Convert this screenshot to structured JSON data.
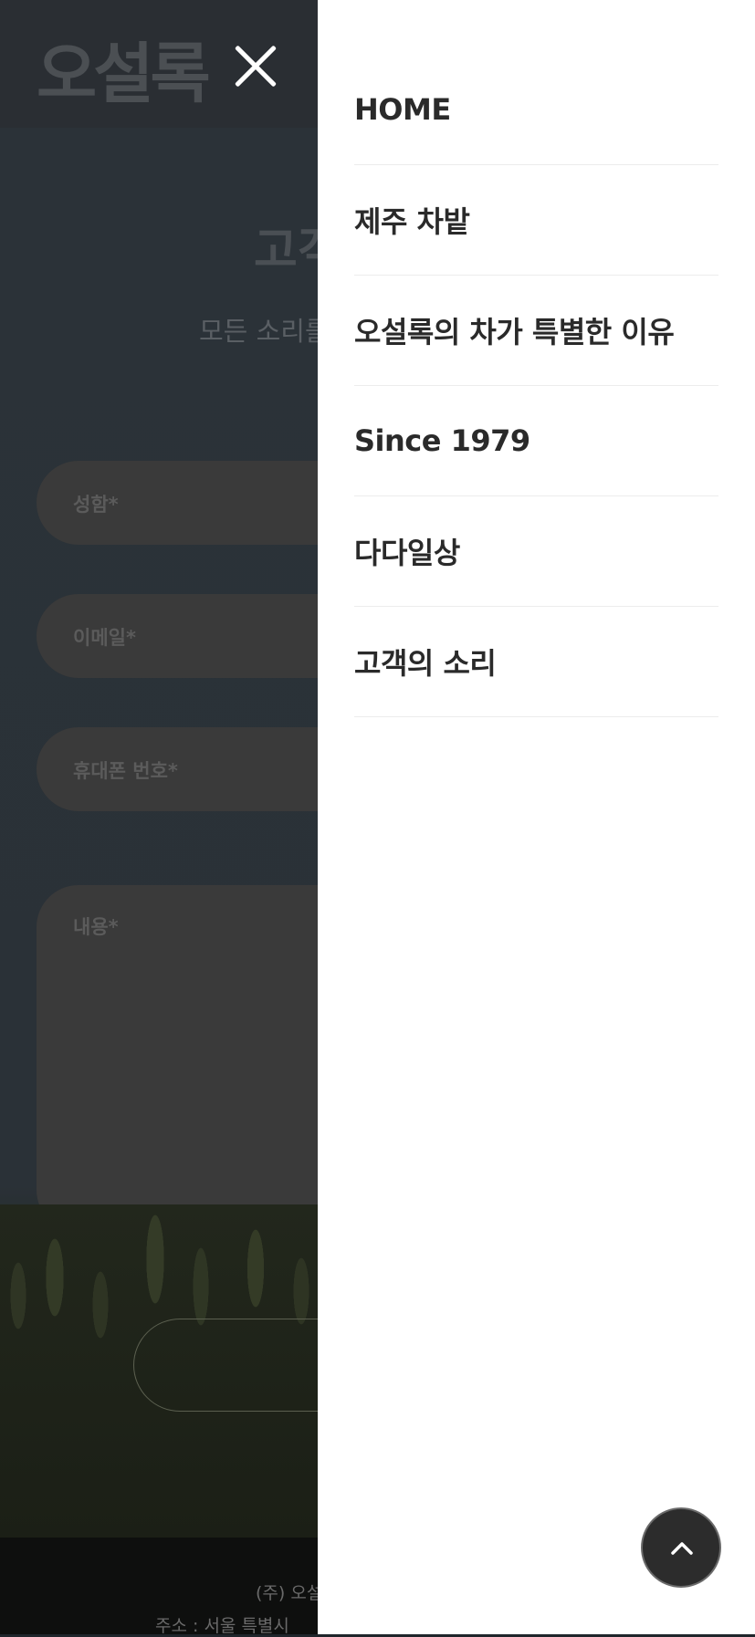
{
  "background": {
    "logo": "오설록",
    "title": "고객",
    "subtitle": "모든 소리를",
    "form": {
      "name_placeholder": "성함*",
      "email_placeholder": "이메일*",
      "phone_placeholder": "휴대폰 번호*",
      "content_placeholder": "내용*"
    },
    "footer": {
      "line1": "(주) 오설",
      "line2": "주소 : 서울 특별시"
    }
  },
  "menu": {
    "items": [
      {
        "label": "HOME"
      },
      {
        "label": "제주 차밭"
      },
      {
        "label": "오설록의 차가 특별한 이유"
      },
      {
        "label": "Since 1979"
      },
      {
        "label": "다다일상"
      },
      {
        "label": "고객의 소리"
      }
    ]
  },
  "icons": {
    "close": "close-icon",
    "scroll_top": "chevron-up-icon"
  },
  "colors": {
    "drawer_bg": "#ffffff",
    "menu_text": "#2a2a2a",
    "overlay": "#1f252b",
    "top_button": "#2c2c2c"
  }
}
